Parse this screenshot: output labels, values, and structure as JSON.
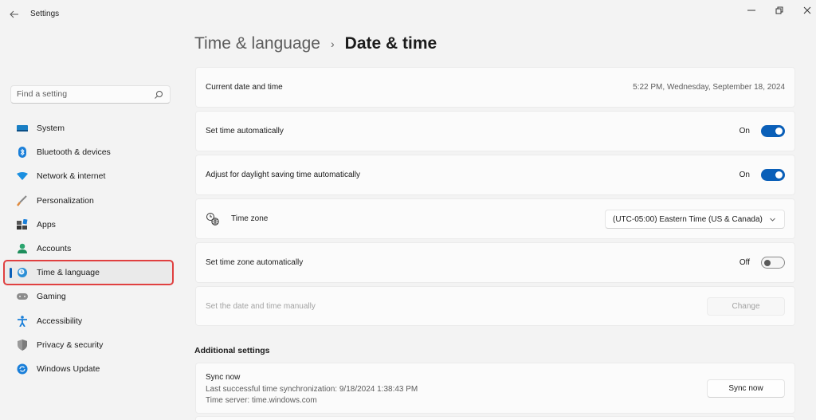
{
  "window": {
    "title": "Settings",
    "controls": {
      "minimize": "—",
      "maximize": "❐",
      "close": "✕"
    }
  },
  "search": {
    "placeholder": "Find a setting",
    "value": ""
  },
  "sidebar": {
    "items": [
      {
        "label": "System",
        "icon": "system-icon",
        "active": false
      },
      {
        "label": "Bluetooth & devices",
        "icon": "bluetooth-icon",
        "active": false
      },
      {
        "label": "Network & internet",
        "icon": "wifi-icon",
        "active": false
      },
      {
        "label": "Personalization",
        "icon": "brush-icon",
        "active": false
      },
      {
        "label": "Apps",
        "icon": "apps-icon",
        "active": false
      },
      {
        "label": "Accounts",
        "icon": "account-icon",
        "active": false
      },
      {
        "label": "Time & language",
        "icon": "time-language-icon",
        "active": true
      },
      {
        "label": "Gaming",
        "icon": "gamepad-icon",
        "active": false
      },
      {
        "label": "Accessibility",
        "icon": "accessibility-icon",
        "active": false
      },
      {
        "label": "Privacy & security",
        "icon": "shield-icon",
        "active": false
      },
      {
        "label": "Windows Update",
        "icon": "update-icon",
        "active": false
      }
    ]
  },
  "header": {
    "breadcrumb_parent": "Time & language",
    "separator": "›",
    "current": "Date & time"
  },
  "settings": {
    "current_datetime": {
      "label": "Current date and time",
      "value": "5:22 PM, Wednesday, September 18, 2024"
    },
    "set_time_auto": {
      "label": "Set time automatically",
      "state": "On",
      "on": true
    },
    "daylight_saving": {
      "label": "Adjust for daylight saving time automatically",
      "state": "On",
      "on": true
    },
    "time_zone": {
      "label": "Time zone",
      "selected": "(UTC-05:00) Eastern Time (US & Canada)"
    },
    "set_tz_auto": {
      "label": "Set time zone automatically",
      "state": "Off",
      "on": false
    },
    "manual": {
      "label": "Set the date and time manually",
      "button": "Change",
      "disabled": true
    }
  },
  "additional": {
    "title": "Additional settings",
    "sync": {
      "label": "Sync now",
      "last_sync": "Last successful time synchronization: 9/18/2024 1:38:43 PM",
      "server": "Time server: time.windows.com",
      "button": "Sync now"
    }
  },
  "colors": {
    "accent": "#0a5fb8",
    "highlight_box": "#e04040"
  }
}
